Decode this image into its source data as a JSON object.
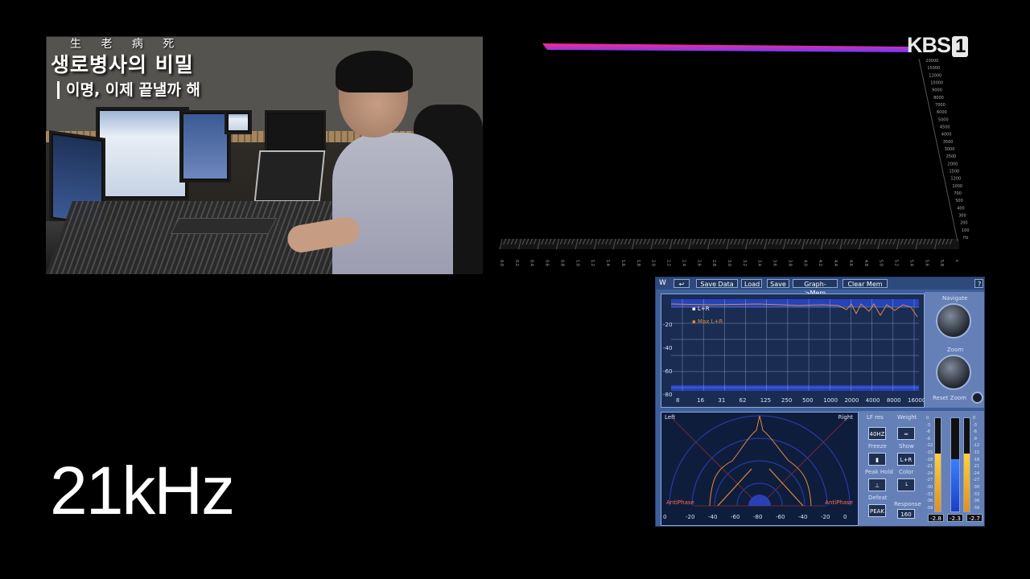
{
  "video": {
    "program_title_hanja": "生 老 病 死",
    "program_title": "생로병사의 비밀",
    "episode_subtitle": "이명, 이제 끝낼까 해"
  },
  "broadcaster": {
    "logo_text": "KBS",
    "channel_number": "1"
  },
  "spectrum_3d": {
    "frequency_labels_hz": [
      "20000",
      "15000",
      "12000",
      "10000",
      "9000",
      "8000",
      "7000",
      "6000",
      "5000",
      "4500",
      "4000",
      "3500",
      "3000",
      "2500",
      "2000",
      "1500",
      "1200",
      "1000",
      "700",
      "500",
      "400",
      "300",
      "200",
      "100",
      "Hz"
    ],
    "time_labels": [
      "0.0",
      "0.2",
      "0.4",
      "0.6",
      "0.8",
      "1.0",
      "1.2",
      "1.4",
      "1.6",
      "1.8",
      "2.0",
      "2.2",
      "2.4",
      "2.6",
      "2.8",
      "3.0",
      "3.2",
      "3.4",
      "3.6",
      "3.8",
      "4.0",
      "4.2",
      "4.4",
      "4.6",
      "4.8",
      "5.0",
      "5.2",
      "5.4",
      "5.6",
      "5.8",
      "s"
    ],
    "band_colors": [
      "#ff2a8a",
      "#6a3cff"
    ]
  },
  "analyzer": {
    "toolbar": {
      "logo": "W",
      "buttons": [
        "Save Data",
        "Load",
        "Save",
        "Graph->Mem",
        "Clear Mem"
      ],
      "help": "?"
    },
    "freq_graph": {
      "y_labels": [
        "-20",
        "-40",
        "-60",
        "-80"
      ],
      "x_labels": [
        "8",
        "16",
        "31",
        "62",
        "125",
        "250",
        "500",
        "1000",
        "2000",
        "4000",
        "8000",
        "16000"
      ],
      "legend": [
        "L+R",
        "Max L+R"
      ],
      "line_color": "#e08a3a"
    },
    "nav": {
      "navigate_label": "Navigate",
      "zoom_label": "Zoom",
      "reset_zoom_label": "Reset Zoom"
    },
    "stereo": {
      "left_label": "Left",
      "right_label": "Right",
      "anti_phase_left": "AntiPhase",
      "anti_phase_right": "AntiPhase",
      "x_labels": [
        "0",
        "-20",
        "-40",
        "-60",
        "-80",
        "-60",
        "-40",
        "-20",
        "0"
      ]
    },
    "controls": {
      "lf_res_label": "LF res",
      "lf_res_value": "40HZ",
      "weight_label": "Weight",
      "freeze_label": "Freeze",
      "show_label": "Show",
      "show_value": "L+R",
      "peak_hold_label": "Peak Hold",
      "color_label": "Color",
      "defeat_label": "Defeat",
      "defeat_value": "PEAK",
      "response_label": "Response",
      "response_value": "160"
    },
    "meters": {
      "scale": [
        "0",
        "-3",
        "-6",
        "-9",
        "-12",
        "-15",
        "-18",
        "-21",
        "-24",
        "-27",
        "-30",
        "-33",
        "-36",
        "-39"
      ],
      "levels": [
        0.62,
        0.56,
        0.62
      ],
      "readouts": [
        "-2.8",
        "-2.3",
        "-2.7"
      ]
    }
  },
  "caption": {
    "text": "21kHz"
  }
}
